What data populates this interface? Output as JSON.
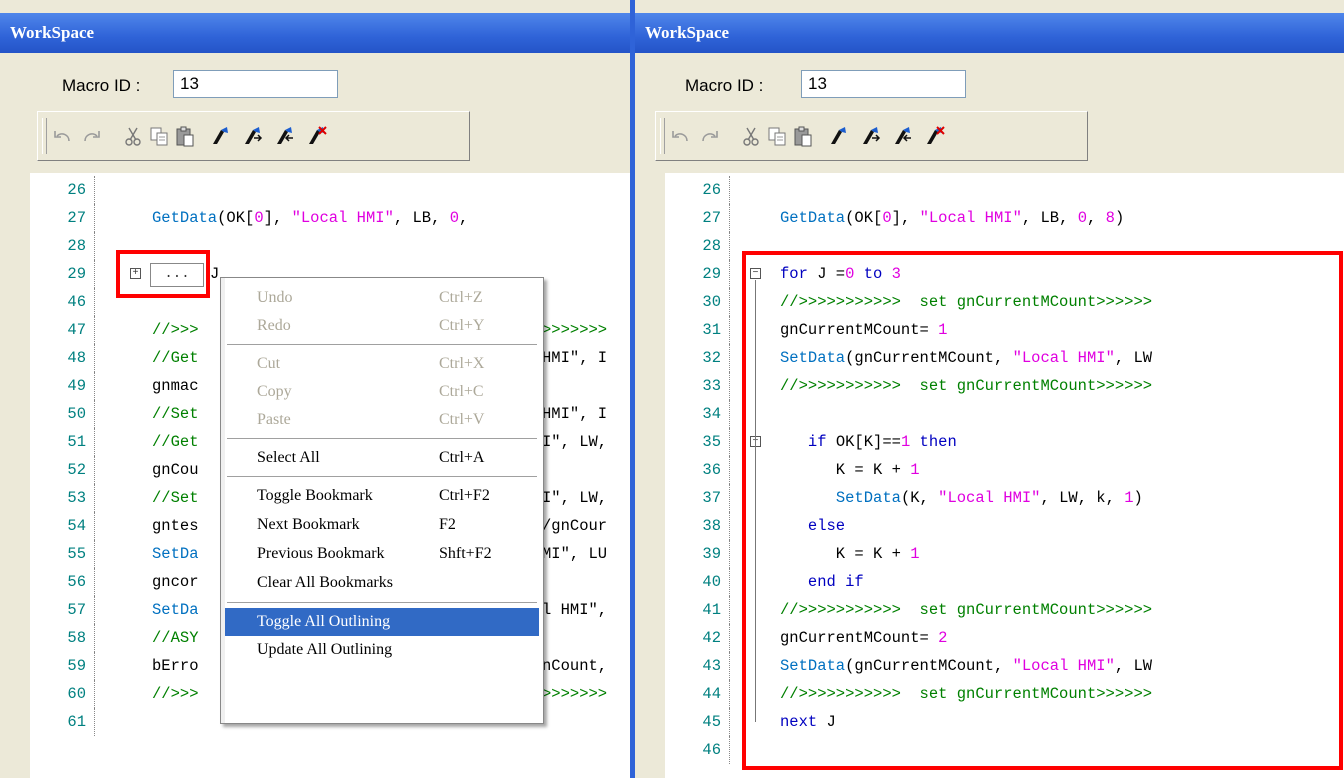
{
  "left": {
    "title": "WorkSpace",
    "macro_label": "Macro ID :",
    "macro_value": "13",
    "lines": [
      {
        "n": "26",
        "code": ""
      },
      {
        "n": "27",
        "code": "GetData(OK[0], \"Local HMI\", LB, 0,"
      },
      {
        "n": "28",
        "code": ""
      },
      {
        "n": "29",
        "code": "...",
        "collapsed": true,
        "trail": "J"
      },
      {
        "n": "46",
        "code": ""
      },
      {
        "n": "47",
        "code": "//>>>"
      },
      {
        "n": "48",
        "code": "//Get"
      },
      {
        "n": "49",
        "code": "gnmac"
      },
      {
        "n": "50",
        "code": "//Set"
      },
      {
        "n": "51",
        "code": "//Get"
      },
      {
        "n": "52",
        "code": "gnCou"
      },
      {
        "n": "53",
        "code": "//Set"
      },
      {
        "n": "54",
        "code": "gntes"
      },
      {
        "n": "55",
        "code": "SetDa"
      },
      {
        "n": "56",
        "code": "gncor"
      },
      {
        "n": "57",
        "code": "SetDa"
      },
      {
        "n": "58",
        "code": "//ASY"
      },
      {
        "n": "59",
        "code": "bErro"
      },
      {
        "n": "60",
        "code": "//>>>"
      },
      {
        "n": "61",
        "code": ""
      }
    ],
    "peek": [
      {
        "row": 5,
        "text": ">>>>>>>"
      },
      {
        "row": 6,
        "text": "HMI\", I"
      },
      {
        "row": 8,
        "text": "HMI\", I"
      },
      {
        "row": 9,
        "text": "I\", LW,"
      },
      {
        "row": 11,
        "text": "I\", LW,"
      },
      {
        "row": 12,
        "text": "/gnCour"
      },
      {
        "row": 13,
        "text": "MI\", LU"
      },
      {
        "row": 15,
        "text": "l HMI\","
      },
      {
        "row": 17,
        "text": "nCount,"
      },
      {
        "row": 18,
        "text": ">>>>>>>"
      }
    ]
  },
  "context_menu": {
    "items": [
      {
        "label": "Undo",
        "shortcut": "Ctrl+Z",
        "disabled": true
      },
      {
        "label": "Redo",
        "shortcut": "Ctrl+Y",
        "disabled": true
      },
      {
        "sep": true
      },
      {
        "label": "Cut",
        "shortcut": "Ctrl+X",
        "disabled": true
      },
      {
        "label": "Copy",
        "shortcut": "Ctrl+C",
        "disabled": true
      },
      {
        "label": "Paste",
        "shortcut": "Ctrl+V",
        "disabled": true
      },
      {
        "sep": true
      },
      {
        "label": "Select All",
        "shortcut": "Ctrl+A"
      },
      {
        "sep": true
      },
      {
        "label": "Toggle Bookmark",
        "shortcut": "Ctrl+F2"
      },
      {
        "label": "Next Bookmark",
        "shortcut": "F2"
      },
      {
        "label": "Previous Bookmark",
        "shortcut": "Shft+F2"
      },
      {
        "label": "Clear All Bookmarks",
        "shortcut": ""
      },
      {
        "sep": true
      },
      {
        "label": "Toggle All Outlining",
        "shortcut": "",
        "highlighted": true
      },
      {
        "label": "Update All Outlining",
        "shortcut": ""
      }
    ]
  },
  "right": {
    "title": "WorkSpace",
    "macro_label": "Macro ID :",
    "macro_value": "13",
    "lines": [
      {
        "n": "26",
        "segs": []
      },
      {
        "n": "27",
        "segs": [
          [
            "fn",
            "GetData"
          ],
          [
            "",
            "(OK["
          ],
          [
            "num",
            "0"
          ],
          [
            "",
            "], "
          ],
          [
            "str",
            "\"Local HMI\""
          ],
          [
            "",
            ", LB, "
          ],
          [
            "num",
            "0"
          ],
          [
            "",
            ", "
          ],
          [
            "num",
            "8"
          ],
          [
            "",
            ")"
          ]
        ]
      },
      {
        "n": "28",
        "segs": []
      },
      {
        "n": "29",
        "segs": [
          [
            "kw",
            "for"
          ],
          [
            "",
            " J ="
          ],
          [
            "num",
            "0"
          ],
          [
            "kw",
            " to "
          ],
          [
            "num",
            "3"
          ]
        ],
        "fold": "-"
      },
      {
        "n": "30",
        "segs": [
          [
            "cmt",
            "//>>>>>>>>>>>  set gnCurrentMCount>>>>>>"
          ]
        ]
      },
      {
        "n": "31",
        "segs": [
          [
            "",
            "gnCurrentMCount= "
          ],
          [
            "num",
            "1"
          ]
        ]
      },
      {
        "n": "32",
        "segs": [
          [
            "fn",
            "SetData"
          ],
          [
            "",
            "(gnCurrentMCount, "
          ],
          [
            "str",
            "\"Local HMI\""
          ],
          [
            "",
            ", LW"
          ]
        ]
      },
      {
        "n": "33",
        "segs": [
          [
            "cmt",
            "//>>>>>>>>>>>  set gnCurrentMCount>>>>>>"
          ]
        ]
      },
      {
        "n": "34",
        "segs": []
      },
      {
        "n": "35",
        "segs": [
          [
            "",
            "   "
          ],
          [
            "kw",
            "if"
          ],
          [
            "",
            " OK[K]=="
          ],
          [
            "num",
            "1"
          ],
          [
            "kw",
            " then"
          ]
        ],
        "fold": "-"
      },
      {
        "n": "36",
        "segs": [
          [
            "",
            "      K = K + "
          ],
          [
            "num",
            "1"
          ]
        ]
      },
      {
        "n": "37",
        "segs": [
          [
            "",
            "      "
          ],
          [
            "fn",
            "SetData"
          ],
          [
            "",
            "(K, "
          ],
          [
            "str",
            "\"Local HMI\""
          ],
          [
            "",
            ", LW, k, "
          ],
          [
            "num",
            "1"
          ],
          [
            "",
            ")"
          ]
        ]
      },
      {
        "n": "38",
        "segs": [
          [
            "",
            "   "
          ],
          [
            "kw",
            "else"
          ]
        ]
      },
      {
        "n": "39",
        "segs": [
          [
            "",
            "      K = K + "
          ],
          [
            "num",
            "1"
          ]
        ]
      },
      {
        "n": "40",
        "segs": [
          [
            "",
            "   "
          ],
          [
            "kw",
            "end if"
          ]
        ]
      },
      {
        "n": "41",
        "segs": [
          [
            "cmt",
            "//>>>>>>>>>>>  set gnCurrentMCount>>>>>>"
          ]
        ]
      },
      {
        "n": "42",
        "segs": [
          [
            "",
            "gnCurrentMCount= "
          ],
          [
            "num",
            "2"
          ]
        ]
      },
      {
        "n": "43",
        "segs": [
          [
            "fn",
            "SetData"
          ],
          [
            "",
            "(gnCurrentMCount, "
          ],
          [
            "str",
            "\"Local HMI\""
          ],
          [
            "",
            ", LW"
          ]
        ]
      },
      {
        "n": "44",
        "segs": [
          [
            "cmt",
            "//>>>>>>>>>>>  set gnCurrentMCount>>>>>>"
          ]
        ]
      },
      {
        "n": "45",
        "segs": [
          [
            "kw",
            "next"
          ],
          [
            "",
            " J"
          ]
        ]
      },
      {
        "n": "46",
        "segs": []
      }
    ]
  },
  "toolbar_icons": [
    "undo-icon",
    "redo-icon",
    "cut-icon",
    "copy-icon",
    "paste-icon",
    "toggle-bookmark-icon",
    "next-bookmark-icon",
    "previous-bookmark-icon",
    "clear-bookmarks-icon"
  ],
  "colors": {
    "title_bar": "#2f63d8",
    "highlight": "#316ac5",
    "annotation": "#ff0000",
    "keyword": "#0000c0",
    "string": "#e000e0",
    "comment": "#008000",
    "line_number": "#008080"
  }
}
